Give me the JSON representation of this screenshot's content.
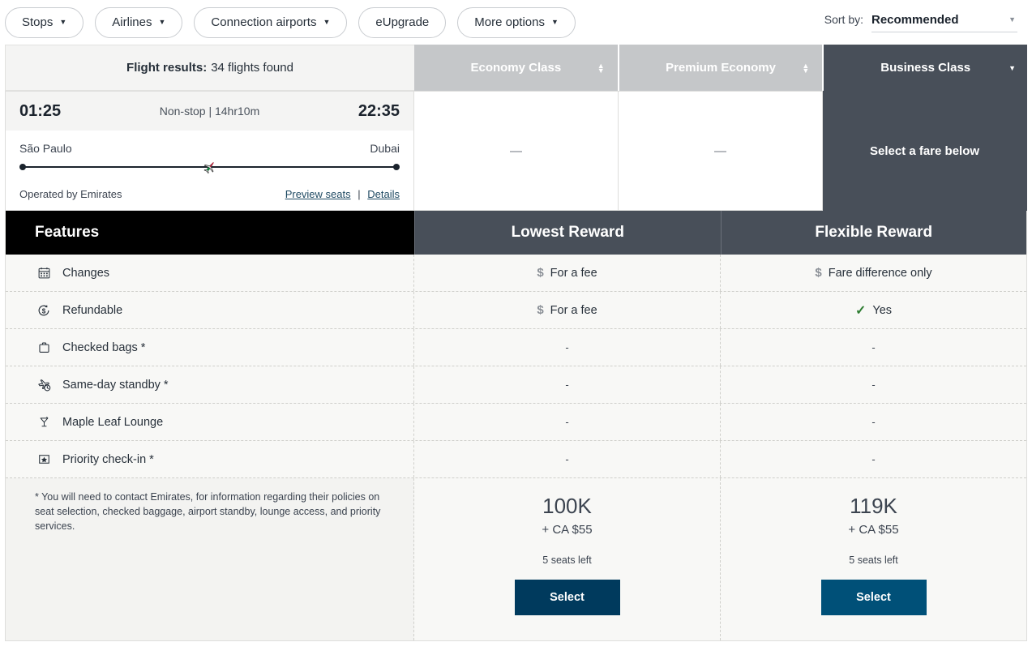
{
  "filters": {
    "pills": [
      {
        "label": "Stops",
        "caret": true,
        "name": "filter-stops"
      },
      {
        "label": "Airlines",
        "caret": true,
        "name": "filter-airlines"
      },
      {
        "label": "Connection airports",
        "caret": true,
        "name": "filter-connection-airports"
      },
      {
        "label": "eUpgrade",
        "caret": false,
        "name": "filter-eupgrade"
      },
      {
        "label": "More options",
        "caret": true,
        "name": "filter-more-options"
      }
    ],
    "sort": {
      "label": "Sort by:",
      "value": "Recommended"
    }
  },
  "results": {
    "title": "Flight results:",
    "count_text": "34 flights found"
  },
  "cabins": [
    {
      "label": "Economy Class",
      "selected": false,
      "control": "sort-arrows"
    },
    {
      "label": "Premium Economy",
      "selected": false,
      "control": "sort-arrows"
    },
    {
      "label": "Business Class",
      "selected": true,
      "control": "caret-down"
    }
  ],
  "flight": {
    "depart_time": "01:25",
    "arrive_time": "22:35",
    "stops_duration": "Non-stop | 14hr10m",
    "origin": "São Paulo",
    "destination": "Dubai",
    "operated_by": "Operated by Emirates",
    "preview_seats_link": "Preview seats",
    "link_separator": "|",
    "details_link": "Details",
    "cabin_cells": [
      {
        "text": "—",
        "selected": false
      },
      {
        "text": "—",
        "selected": false
      },
      {
        "text": "Select a fare below",
        "selected": true
      }
    ]
  },
  "fare_table": {
    "features_header": "Features",
    "columns": [
      {
        "header": "Lowest Reward"
      },
      {
        "header": "Flexible Reward"
      }
    ],
    "rows": [
      {
        "icon": "calendar-icon",
        "label": "Changes",
        "values": [
          {
            "icon": "dollar-icon",
            "text": "For a fee"
          },
          {
            "icon": "dollar-icon",
            "text": "Fare difference only"
          }
        ]
      },
      {
        "icon": "refund-dollar-icon",
        "label": "Refundable",
        "values": [
          {
            "icon": "dollar-icon",
            "text": "For a fee"
          },
          {
            "icon": "check-icon",
            "text": "Yes"
          }
        ]
      },
      {
        "icon": "briefcase-icon",
        "label": "Checked bags *",
        "values": [
          {
            "icon": "none",
            "text": "-"
          },
          {
            "icon": "none",
            "text": "-"
          }
        ]
      },
      {
        "icon": "standby-plane-icon",
        "label": "Same-day standby *",
        "values": [
          {
            "icon": "none",
            "text": "-"
          },
          {
            "icon": "none",
            "text": "-"
          }
        ]
      },
      {
        "icon": "lounge-glass-icon",
        "label": "Maple Leaf Lounge",
        "values": [
          {
            "icon": "none",
            "text": "-"
          },
          {
            "icon": "none",
            "text": "-"
          }
        ]
      },
      {
        "icon": "priority-star-icon",
        "label": "Priority check-in *",
        "values": [
          {
            "icon": "none",
            "text": "-"
          },
          {
            "icon": "none",
            "text": "-"
          }
        ]
      }
    ],
    "footnote": "* You will need to contact Emirates, for information regarding their policies on seat selection, checked baggage, airport standby, lounge access, and priority services.",
    "prices": [
      {
        "points": "100K",
        "cash": "+ CA $55",
        "seats_left": "5 seats left",
        "button_label": "Select",
        "button_color": "#003a5d"
      },
      {
        "points": "119K",
        "cash": "+ CA $55",
        "seats_left": "5 seats left",
        "button_label": "Select",
        "button_color": "#005078"
      }
    ]
  },
  "colors": {
    "selected_tab": "#484f59",
    "features_header_bg": "#000000",
    "check_green": "#2e7d32",
    "link_blue": "#1f4a63"
  }
}
